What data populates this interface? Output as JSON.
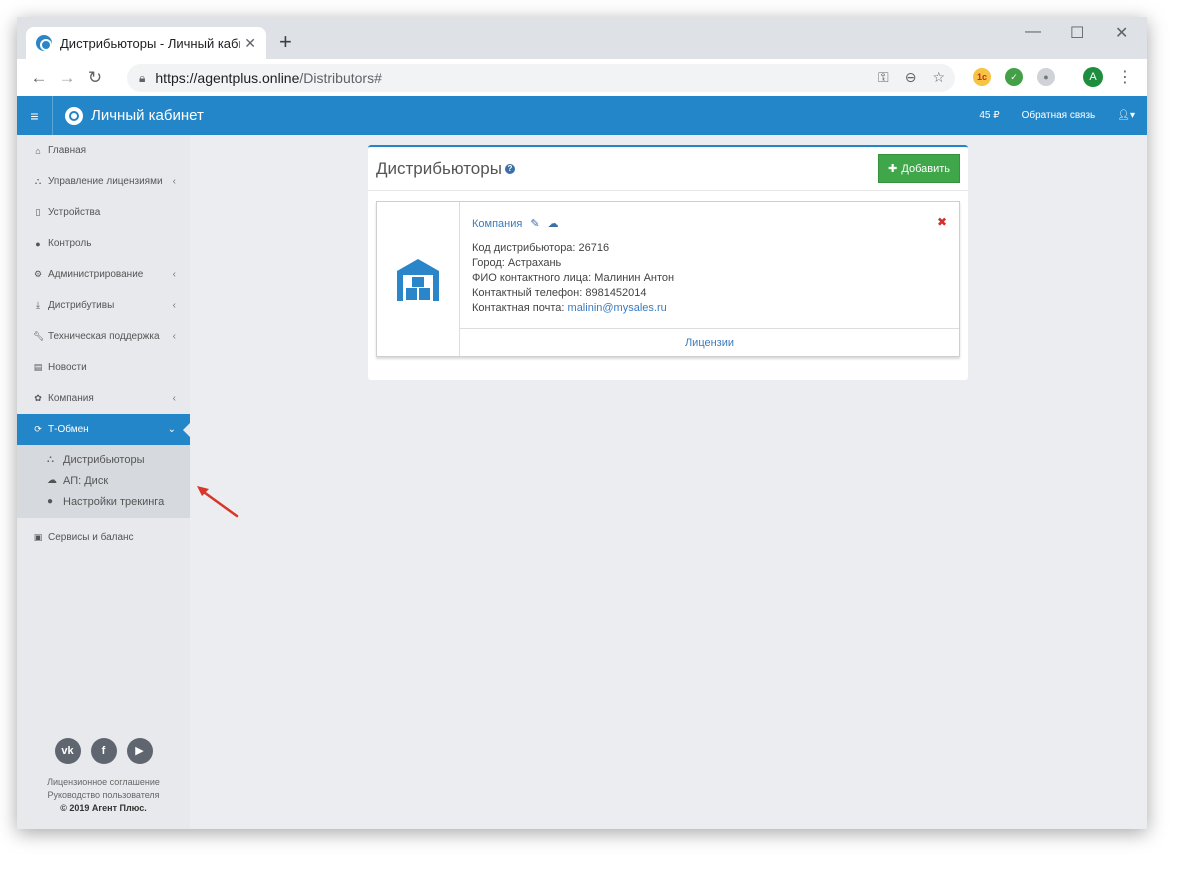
{
  "browser": {
    "tab_title": "Дистрибьюторы - Личный каби",
    "url_host": "https://agentplus.online",
    "url_path": "/Distributors#",
    "profile_initial": "A"
  },
  "header": {
    "brand": "Личный кабинет",
    "balance": "45 ₽",
    "feedback": "Обратная связь"
  },
  "sidebar": {
    "items": [
      {
        "label": "Главная",
        "icon": "home-icon"
      },
      {
        "label": "Управление лицензиями",
        "icon": "sitemap-icon",
        "chevron": "‹"
      },
      {
        "label": "Устройства",
        "icon": "mobile-icon"
      },
      {
        "label": "Контроль",
        "icon": "globe-icon"
      },
      {
        "label": "Администрирование",
        "icon": "cogs-icon",
        "chevron": "‹"
      },
      {
        "label": "Дистрибутивы",
        "icon": "download-icon",
        "chevron": "‹"
      },
      {
        "label": "Техническая поддержка",
        "icon": "wrench-icon",
        "chevron": "‹"
      },
      {
        "label": "Новости",
        "icon": "newspaper-icon"
      },
      {
        "label": "Компания",
        "icon": "gear-icon",
        "chevron": "‹"
      },
      {
        "label": "Т-Обмен",
        "icon": "refresh-icon",
        "chevron": "⌄"
      }
    ],
    "subitems": [
      {
        "label": "Дистрибьюторы",
        "icon": "sitemap-icon"
      },
      {
        "label": "АП: Диск",
        "icon": "cloud-icon"
      },
      {
        "label": "Настройки трекинга",
        "icon": "globe-icon"
      }
    ],
    "bottom_item": {
      "label": "Сервисы и баланс",
      "icon": "money-icon"
    },
    "footer": {
      "license": "Лицензионное соглашение",
      "guide": "Руководство пользователя",
      "copyright": "© 2019 Агент Плюс."
    }
  },
  "main": {
    "title": "Дистрибьюторы",
    "add_label": "Добавить",
    "card": {
      "company": "Компания",
      "code": "Код дистрибьютора: 26716",
      "city": "Город: Астрахань",
      "contact": "ФИО контактного лица: Малинин Антон",
      "phone": "Контактный телефон: 8981452014",
      "email_label": "Контактная почта:",
      "email": "malinin@mysales.ru",
      "licenses": "Лицензии"
    }
  },
  "colors": {
    "accent": "#2386c8",
    "add_button": "#3fa74a",
    "delete": "#d32f2f"
  }
}
